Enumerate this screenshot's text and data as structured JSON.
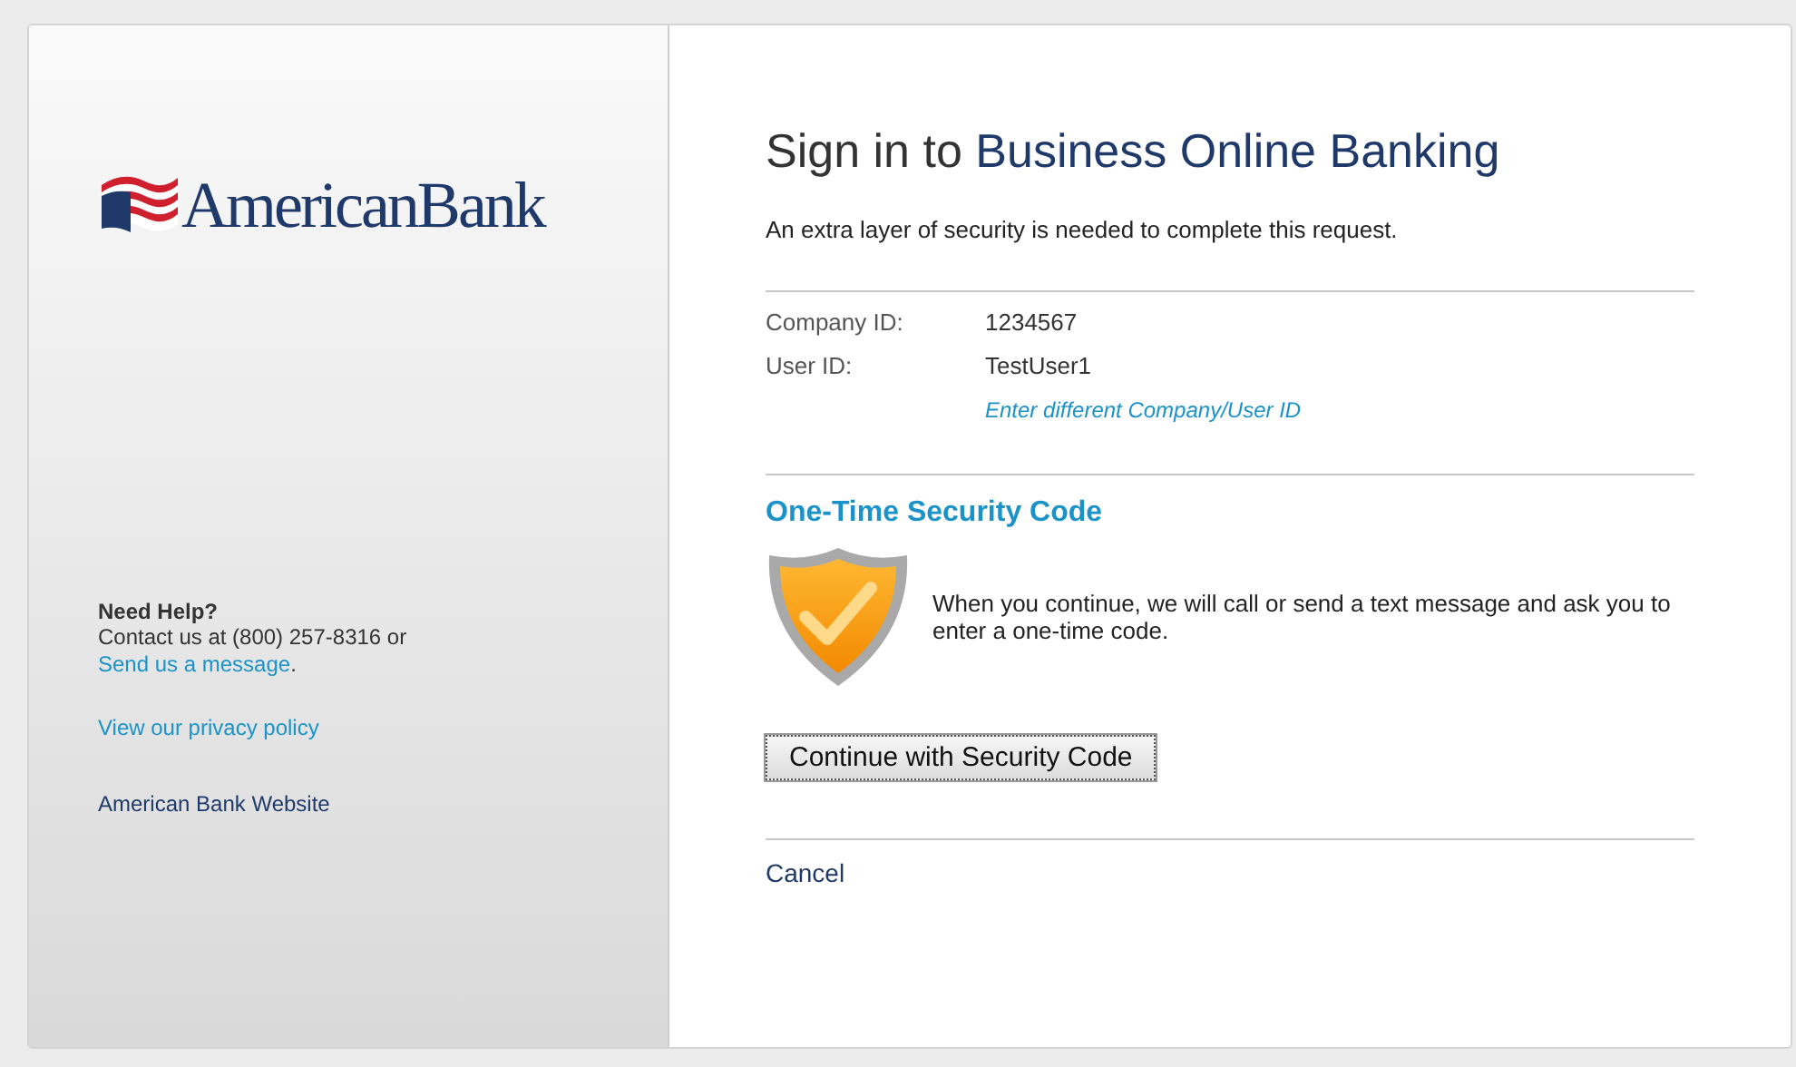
{
  "brand": {
    "name": "AmericanBank"
  },
  "help": {
    "heading": "Need Help?",
    "text": "Contact us at (800) 257-8316 or",
    "link": "Send us a message",
    "after": "."
  },
  "sidebar_links": [
    {
      "label": "View our privacy policy",
      "kind": "accent"
    },
    {
      "label": "American Bank Website",
      "kind": "plain"
    }
  ],
  "title": {
    "lead": "Sign in to",
    "product": "Business Online Banking"
  },
  "intro": "An extra layer of security is needed to complete this request.",
  "fields": [
    {
      "label": "Company ID:",
      "value": "1234567"
    },
    {
      "label": "User ID:",
      "value": "TestUser1"
    }
  ],
  "change_link": "Enter different Company/User ID",
  "security": {
    "heading": "One-Time Security Code",
    "text": "When you continue, we will call or send a text message and ask you to enter a one-time code.",
    "button": "Continue with Security Code"
  },
  "cancel": "Cancel"
}
